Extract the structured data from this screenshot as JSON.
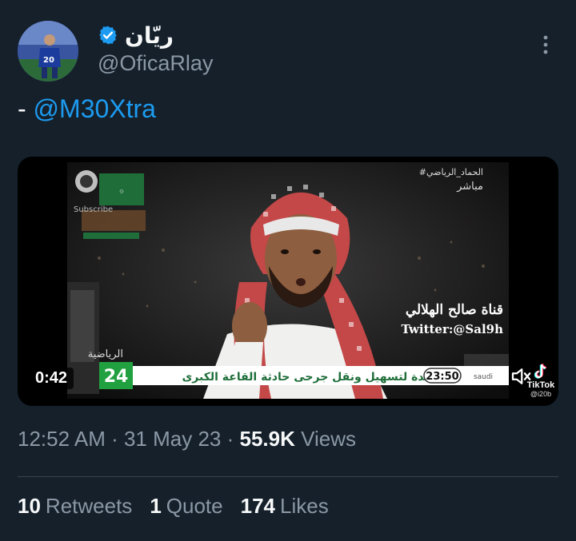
{
  "author": {
    "display_name": "ريّان",
    "handle": "@OficaRlay"
  },
  "tweet": {
    "prefix": "- ",
    "mention": "@M30Xtra"
  },
  "media": {
    "duration": "0:42",
    "video_overlay": {
      "channel_tag": "#الحماد_الرياضي",
      "live_label": "مباشر",
      "channel_name": "قناة صالح الهلالي",
      "twitter_handle": "Twitter:@Sal9h",
      "ticker_text": "حدة لتسهيل ونقل جرحى حادثة القاعة الكبرى",
      "ticker_channel": "24",
      "ticker_time": "23:50",
      "sports_label": "الرياضية",
      "subscribe_label": "Subscribe",
      "saudi_label": "saudi"
    },
    "watermark": {
      "brand": "TikTok",
      "user": "@i20b"
    }
  },
  "meta": {
    "time": "12:52 AM",
    "separator": " · ",
    "date": "31 May 23",
    "views_count": "55.9K",
    "views_label": "Views"
  },
  "stats": {
    "retweets_count": "10",
    "retweets_label": "Retweets",
    "quotes_count": "1",
    "quotes_label": "Quote",
    "likes_count": "174",
    "likes_label": "Likes"
  },
  "icons": {
    "verified": "verified-badge-icon",
    "more": "more-vertical-icon",
    "mute": "speaker-muted-icon",
    "tiktok": "tiktok-logo-icon"
  },
  "colors": {
    "background": "#15202b",
    "accent": "#1d9bf0",
    "secondary_text": "#8b98a5",
    "primary_text": "#f7f9f9",
    "divider": "#38444d"
  }
}
